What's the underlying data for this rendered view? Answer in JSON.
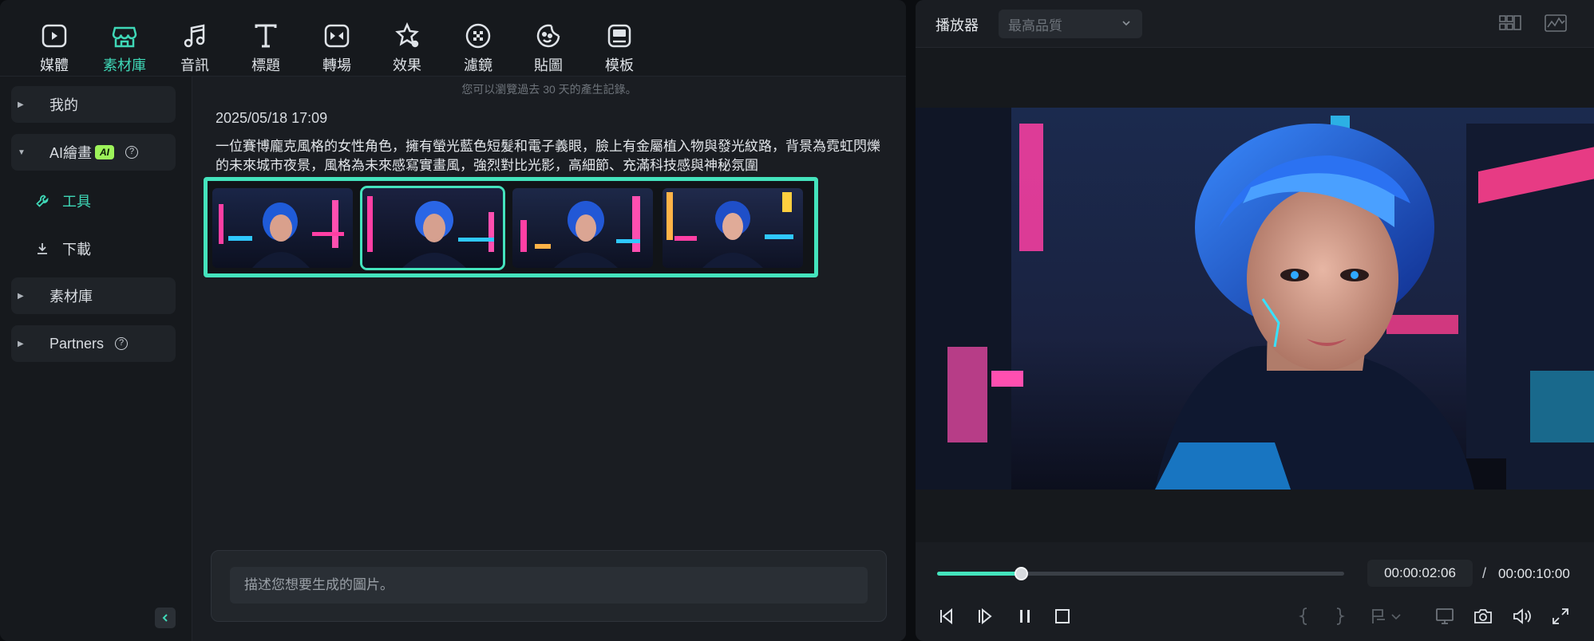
{
  "toolbar": {
    "items": [
      {
        "label": "媒體",
        "icon": "media-icon"
      },
      {
        "label": "素材庫",
        "icon": "store-icon",
        "active": true
      },
      {
        "label": "音訊",
        "icon": "music-note-icon"
      },
      {
        "label": "標題",
        "icon": "title-icon"
      },
      {
        "label": "轉場",
        "icon": "transition-icon"
      },
      {
        "label": "效果",
        "icon": "effects-icon"
      },
      {
        "label": "濾鏡",
        "icon": "filter-icon"
      },
      {
        "label": "貼圖",
        "icon": "sticker-icon"
      },
      {
        "label": "模板",
        "icon": "template-icon"
      }
    ]
  },
  "sidebar": {
    "mine": "我的",
    "ai_painting": "AI繪畫",
    "ai_badge": "AI",
    "tools": "工具",
    "download": "下載",
    "library": "素材庫",
    "partners": "Partners"
  },
  "content": {
    "notice": "您可以瀏覽過去 30 天的產生記錄。",
    "date": "2025/05/18 17:09",
    "prompt": "一位賽博龐克風格的女性角色，擁有螢光藍色短髮和電子義眼，臉上有金屬植入物與發光紋路，背景為霓虹閃爍的未來城市夜景，風格為未來感寫實畫風，強烈對比光影，高細節、充滿科技感與神秘氛圍",
    "selected_thumb": 1,
    "input_placeholder": "描述您想要生成的圖片。"
  },
  "player": {
    "title": "播放器",
    "quality": "最高品質",
    "progress": 0.206,
    "current_time": "00:00:02:06",
    "separator": "/",
    "total_time": "00:00:10:00"
  },
  "colors": {
    "accent": "#44e3bd",
    "badge": "#9df35a"
  }
}
